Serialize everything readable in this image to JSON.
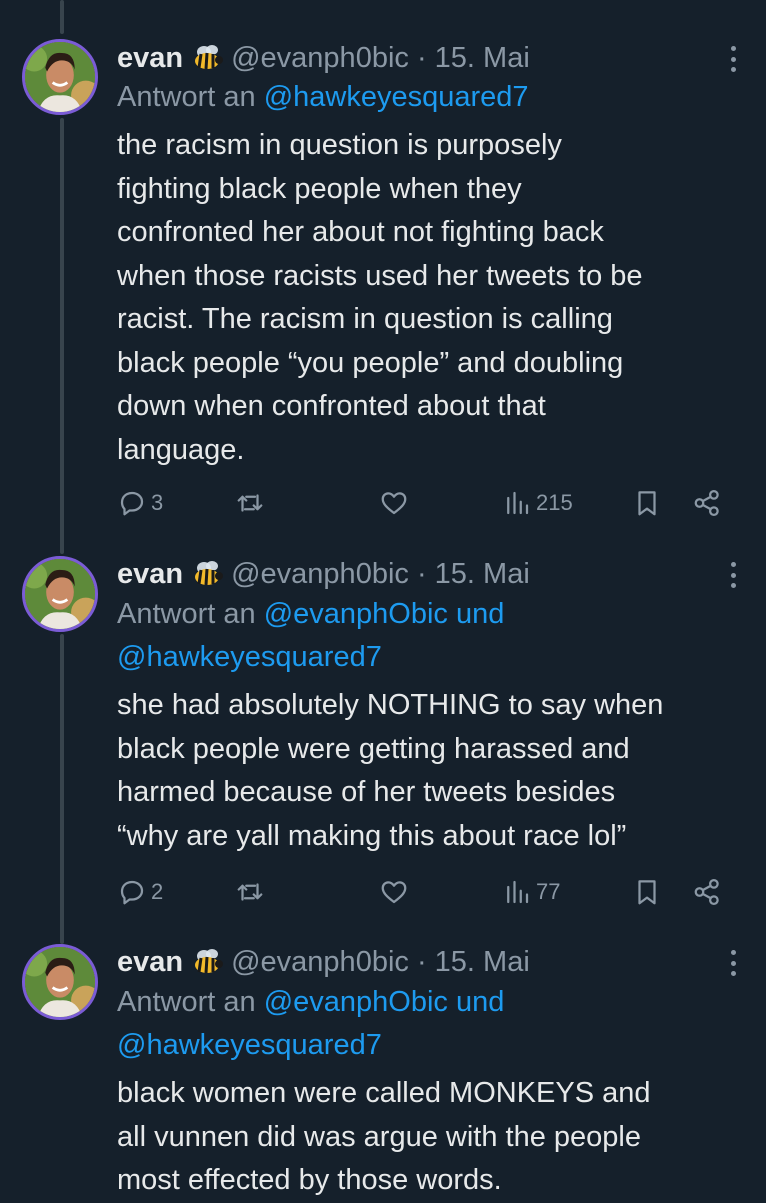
{
  "tweets": [
    {
      "name": "evan",
      "handle": "@evanph0bic",
      "date": "· 15. Mai",
      "reply_prefix": "Antwort an ",
      "reply_line1_link": "@hawkeyesquared7",
      "reply_line2_link": "",
      "body": "the racism in question is purposely\nfighting black people when they\nconfronted her about not fighting back\nwhen those racists used her tweets to be\nracist. The racism in question is calling\nblack people “you people” and doubling\ndown when confronted about that\nlanguage.",
      "replies": "3",
      "views": "215"
    },
    {
      "name": "evan",
      "handle": "@evanph0bic",
      "date": "· 15. Mai",
      "reply_prefix": "Antwort an ",
      "reply_line1_link": "@evanphObic und",
      "reply_line2_link": "@hawkeyesquared7",
      "body": "she had absolutely NOTHING to say when\nblack people were getting harassed and\nharmed because of her tweets besides\n“why are yall making this about race lol”",
      "replies": "2",
      "views": "77"
    },
    {
      "name": "evan",
      "handle": "@evanph0bic",
      "date": "· 15. Mai",
      "reply_prefix": "Antwort an ",
      "reply_line1_link": "@evanphObic und",
      "reply_line2_link": "@hawkeyesquared7",
      "body": "black women were called MONKEYS and\nall vunnen did was argue with the people\nmost effected by those words.",
      "replies": "",
      "views": ""
    }
  ],
  "icons": {
    "name_emoji": "bee-icon",
    "more": "more-icon",
    "reply": "reply-icon",
    "retweet": "retweet-icon",
    "like": "heart-icon",
    "views": "views-icon",
    "bookmark": "bookmark-icon",
    "share": "share-icon"
  },
  "colors": {
    "background": "#15202b",
    "text": "#e7e9ea",
    "secondary": "#8b98a5",
    "link": "#1d9bf0"
  }
}
